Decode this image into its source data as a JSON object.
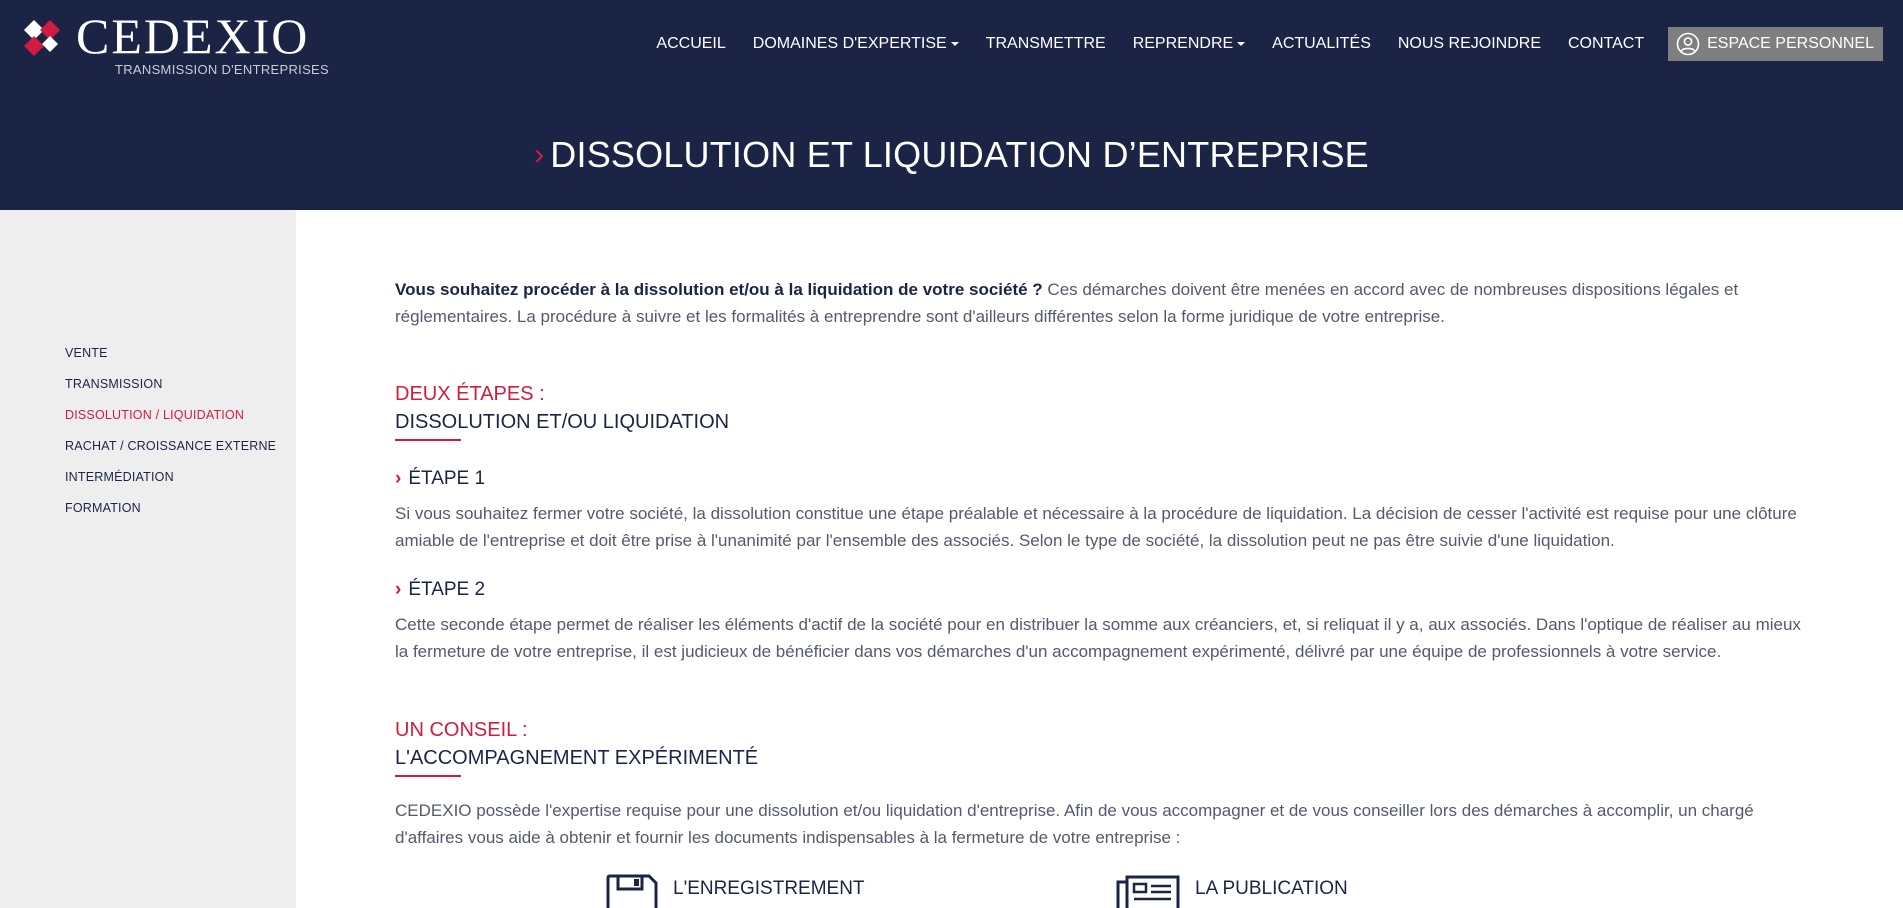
{
  "brand": {
    "name": "CEDEXIO",
    "tagline": "TRANSMISSION D'ENTREPRISES",
    "colors": {
      "navy": "#1c2446",
      "accent": "#d11c41",
      "sidebar": "#eeeeef"
    }
  },
  "nav": {
    "items": [
      {
        "label": "ACCUEIL",
        "dropdown": false
      },
      {
        "label": "DOMAINES D'EXPERTISE",
        "dropdown": true
      },
      {
        "label": "TRANSMETTRE",
        "dropdown": false
      },
      {
        "label": "REPRENDRE",
        "dropdown": true
      },
      {
        "label": "ACTUALITÉS",
        "dropdown": false
      },
      {
        "label": "NOUS REJOINDRE",
        "dropdown": false
      },
      {
        "label": "CONTACT",
        "dropdown": false
      }
    ],
    "account_label": "ESPACE PERSONNEL",
    "account_icon": "user-circle-icon"
  },
  "hero": {
    "chevron": "›",
    "title": "DISSOLUTION ET LIQUIDATION D’ENTREPRISE"
  },
  "sidebar": {
    "items": [
      {
        "label": "VENTE",
        "active": false
      },
      {
        "label": "TRANSMISSION",
        "active": false
      },
      {
        "label": "DISSOLUTION / LIQUIDATION",
        "active": true
      },
      {
        "label": "RACHAT / CROISSANCE EXTERNE",
        "active": false
      },
      {
        "label": "INTERMÉDIATION",
        "active": false
      },
      {
        "label": "FORMATION",
        "active": false
      }
    ]
  },
  "main": {
    "intro_bold": "Vous souhaitez procéder à la dissolution et/ou à la liquidation de votre société ?",
    "intro_rest": " Ces démarches doivent être menées en accord avec de nombreuses dispositions légales et réglementaires. La procédure à suivre et les formalités à entreprendre sont d'ailleurs différentes selon la forme juridique de votre entreprise.",
    "section1": {
      "kicker": "DEUX ÉTAPES :",
      "title": "DISSOLUTION ET/OU LIQUIDATION"
    },
    "steps": [
      {
        "chevron": "›",
        "title": "ÉTAPE 1",
        "text": "Si vous souhaitez fermer votre société, la dissolution constitue une étape préalable et nécessaire à la procédure de liquidation. La décision de cesser l'activité est requise pour une clôture amiable de l'entreprise et doit être prise à l'unanimité par l'ensemble des associés. Selon le type de société, la dissolution peut ne pas être suivie d'une liquidation."
      },
      {
        "chevron": "›",
        "title": "ÉTAPE 2",
        "text": "Cette seconde étape permet de réaliser les éléments d'actif de la société pour en distribuer la somme aux créanciers, et, si reliquat il y a, aux associés. Dans l'optique de réaliser au mieux la fermeture de votre entreprise, il est judicieux de bénéficier dans vos démarches d'un accompagnement expérimenté, délivré par une équipe de professionnels à votre service."
      }
    ],
    "section2": {
      "kicker": "UN CONSEIL :",
      "title": "L'ACCOMPAGNEMENT EXPÉRIMENTÉ",
      "text": "CEDEXIO possède l'expertise requise pour une dissolution et/ou liquidation d'entreprise. Afin de vous accompagner et de vous conseiller lors des démarches à accomplir, un chargé d'affaires vous aide à obtenir et fournir les documents indispensables à la fermeture de votre entreprise :"
    },
    "features": [
      {
        "icon": "floppy-disk-icon",
        "label": "L'ENREGISTREMENT"
      },
      {
        "icon": "newspaper-icon",
        "label": "LA PUBLICATION"
      }
    ]
  }
}
